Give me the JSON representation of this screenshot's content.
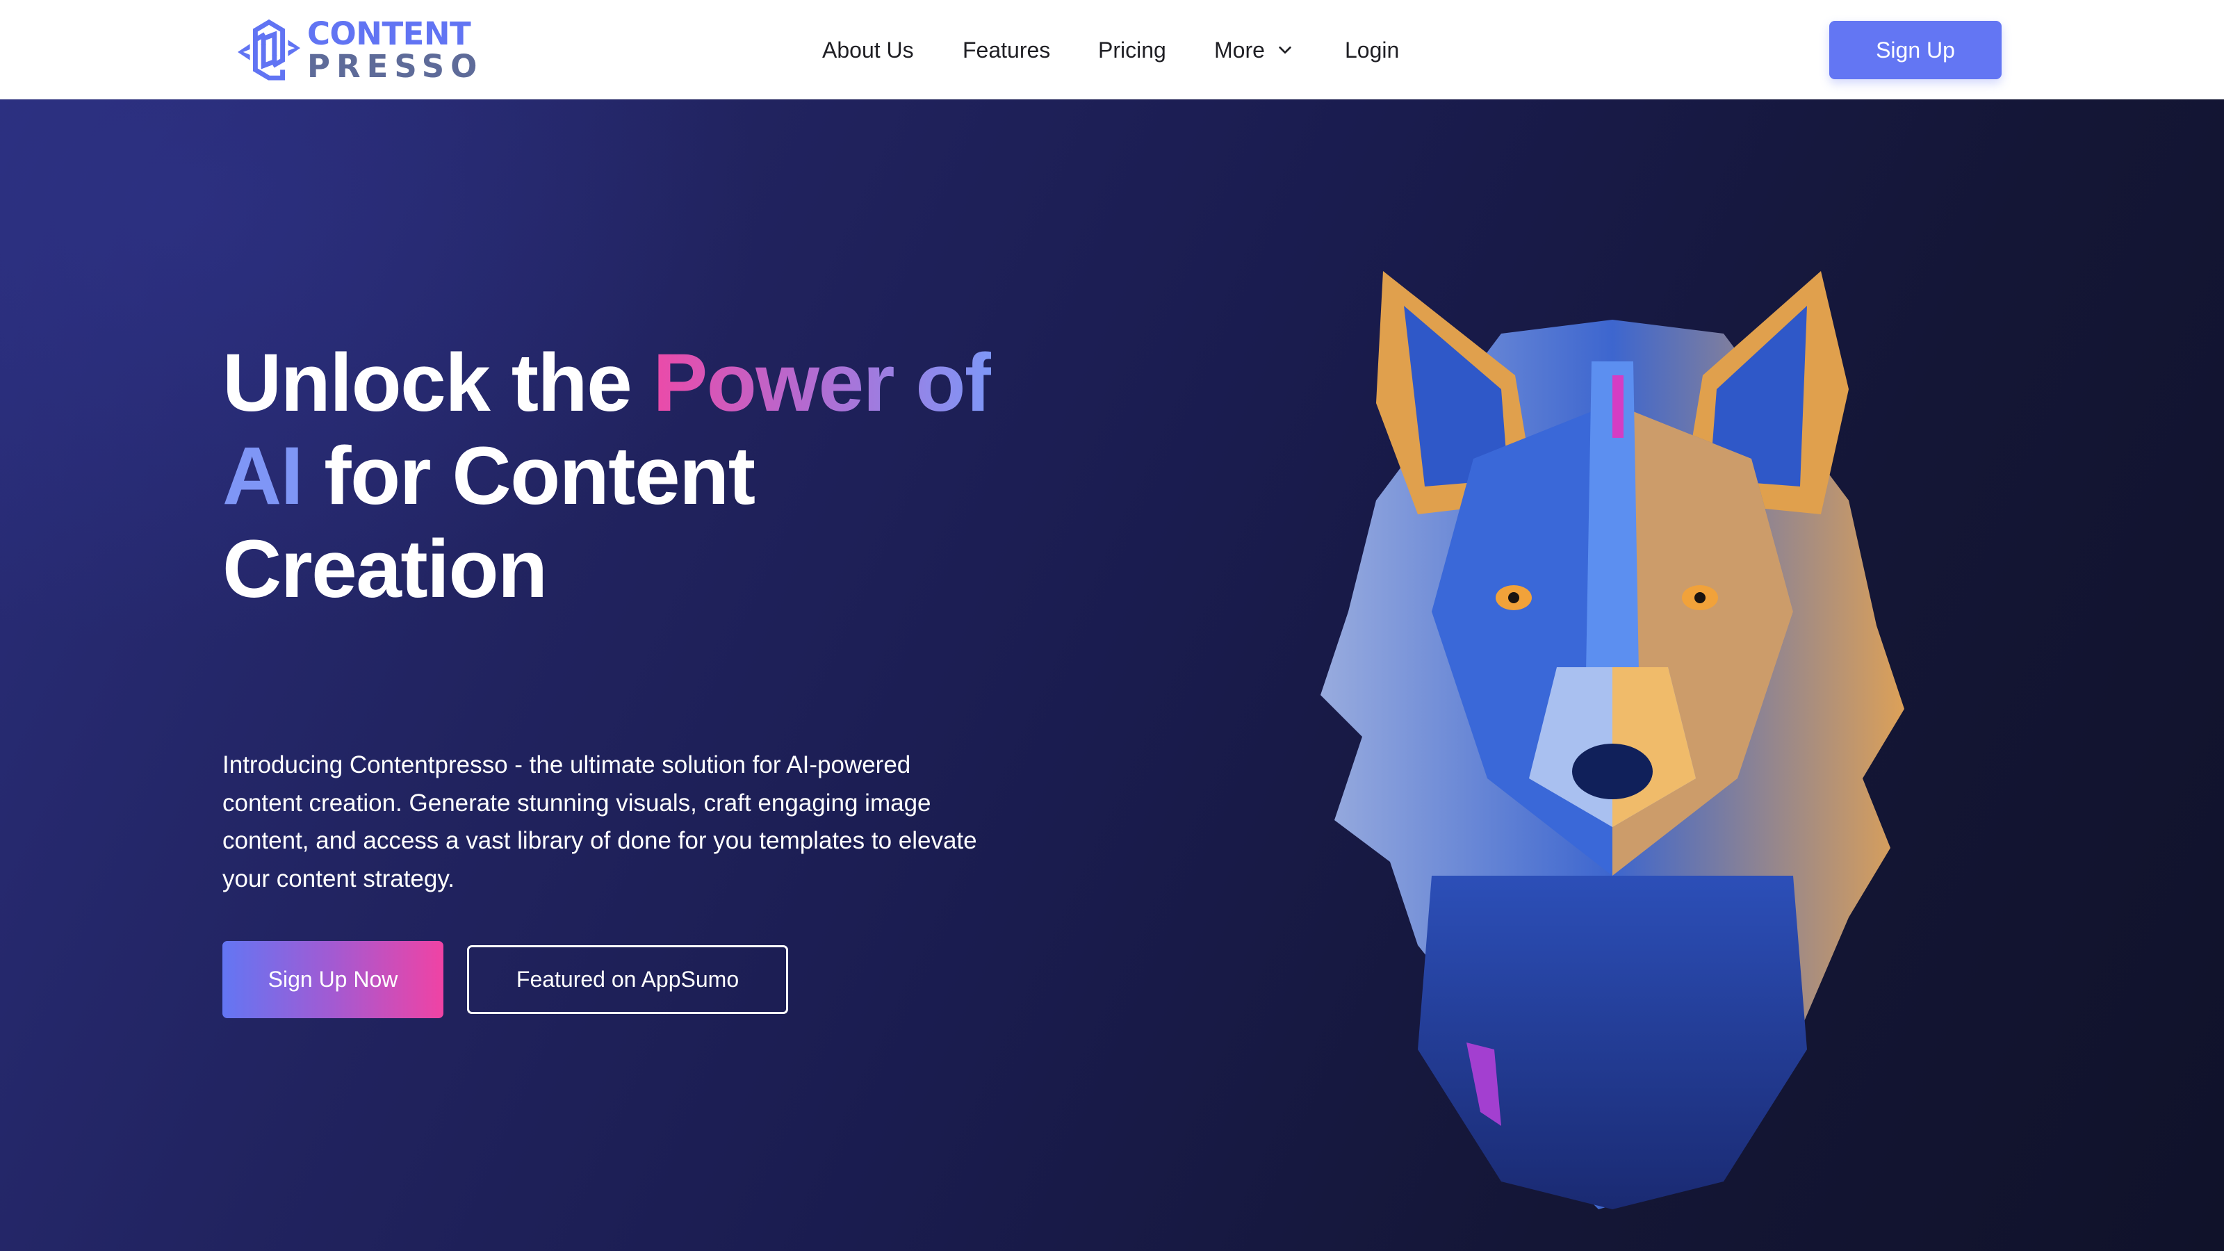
{
  "brand": {
    "name_line1": "CONTENT",
    "name_line2": "PRESSO",
    "logo_icon": "contentpresso-hexagon-logo-icon",
    "colors": {
      "primary": "#6376f3",
      "secondary": "#5e6b99"
    }
  },
  "nav": {
    "links": [
      {
        "label": "About Us"
      },
      {
        "label": "Features"
      },
      {
        "label": "Pricing"
      },
      {
        "label": "More",
        "icon": "chevron-down-icon"
      },
      {
        "label": "Login"
      }
    ],
    "signup_label": "Sign Up"
  },
  "hero": {
    "headline": {
      "part1": "Unlock the ",
      "highlight": "Power of",
      "ai": "AI",
      "part2": " for Content",
      "part3": "Creation"
    },
    "intro": "Introducing Contentpresso - the ultimate solution for AI-powered content creation. Generate stunning visuals, craft engaging image content, and access a vast library of done for you templates to elevate your content strategy.",
    "primary_cta": "Sign Up Now",
    "secondary_cta": "Featured on AppSumo",
    "image": "low-poly-geometric-wolf-head-illustration",
    "colors": {
      "bg_start": "#2a2e7b",
      "bg_end": "#10122a",
      "gradient_pink": "#ec4aa8",
      "gradient_blue": "#7e97f7"
    }
  }
}
